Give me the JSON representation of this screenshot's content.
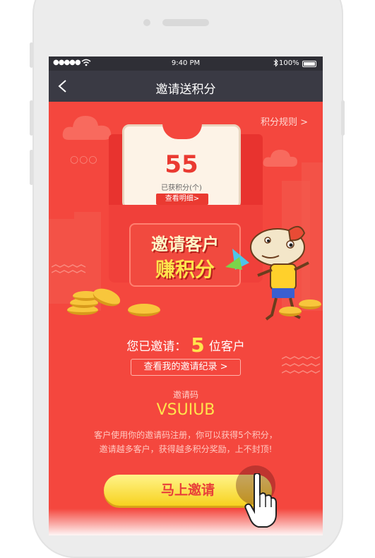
{
  "status_bar": {
    "signal": "●●●●●",
    "time": "9:40 PM",
    "battery": "100%"
  },
  "nav": {
    "title": "邀请送积分"
  },
  "header": {
    "rules_link": "积分规则 >"
  },
  "card": {
    "points": "55",
    "points_label": "已获积分(个)",
    "detail_button": "查看明细>"
  },
  "banner": {
    "line1": "邀请客户",
    "line2": "赚积分"
  },
  "stats": {
    "prefix": "您已邀请：",
    "count": "5",
    "suffix": "位客户",
    "record_button": "查看我的邀请纪录 >"
  },
  "invite": {
    "code_label": "邀请码",
    "code": "VSUIUB",
    "desc_line1": "客户使用你的邀请码注册，你可以获得5个积分，",
    "desc_line2": "邀请越多客户，获得越多积分奖励，上不封顶!",
    "button": "马上邀请"
  },
  "colors": {
    "background": "#f4473e",
    "navbar": "#3a3a44",
    "accent": "#ffe44d"
  }
}
